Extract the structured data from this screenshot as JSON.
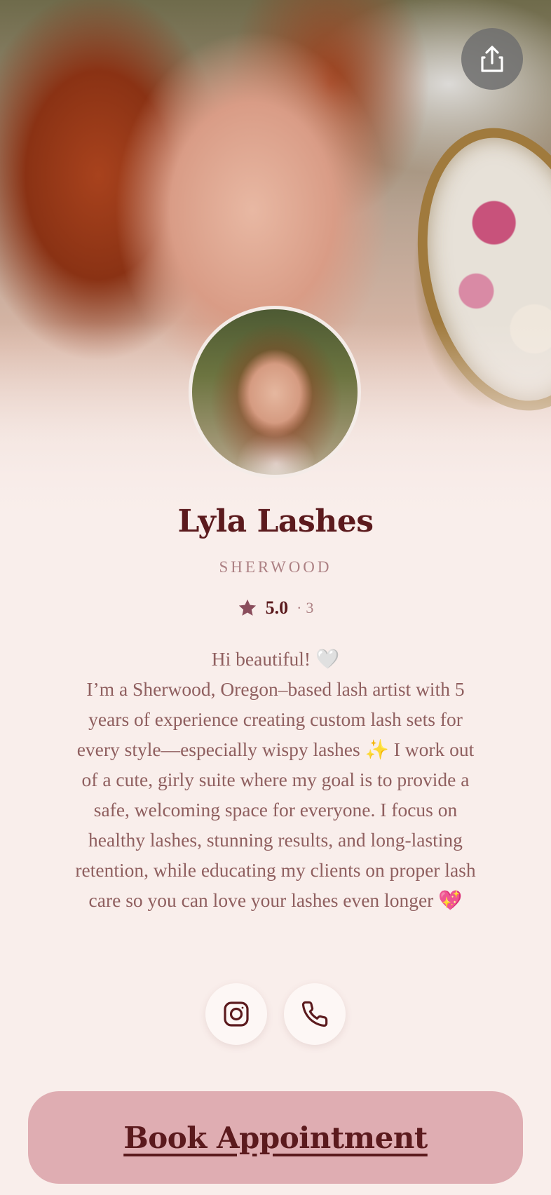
{
  "profile": {
    "name": "Lyla Lashes",
    "location": "SHERWOOD",
    "rating": "5.0",
    "rating_separator": "·",
    "review_count": "3",
    "bio": "Hi beautiful! 🤍\nI’m a Sherwood, Oregon–based lash artist with 5 years of experience creating custom lash sets for every style—especially wispy lashes ✨  I work out of a cute, girly suite where my goal is to provide a safe, welcoming space for everyone. I focus on healthy lashes, stunning results, and long-lasting retention, while educating my clients on proper lash care so you can love your lashes even longer 💖"
  },
  "actions": {
    "share_icon": "share-icon",
    "contacts": [
      {
        "icon": "instagram-icon"
      },
      {
        "icon": "phone-icon"
      }
    ],
    "book_label": "Book Appointment"
  },
  "colors": {
    "background": "#f9eeeb",
    "primary_text": "#5b1a1d",
    "muted_text": "#ad8184",
    "book_button": "#dfadb2"
  }
}
